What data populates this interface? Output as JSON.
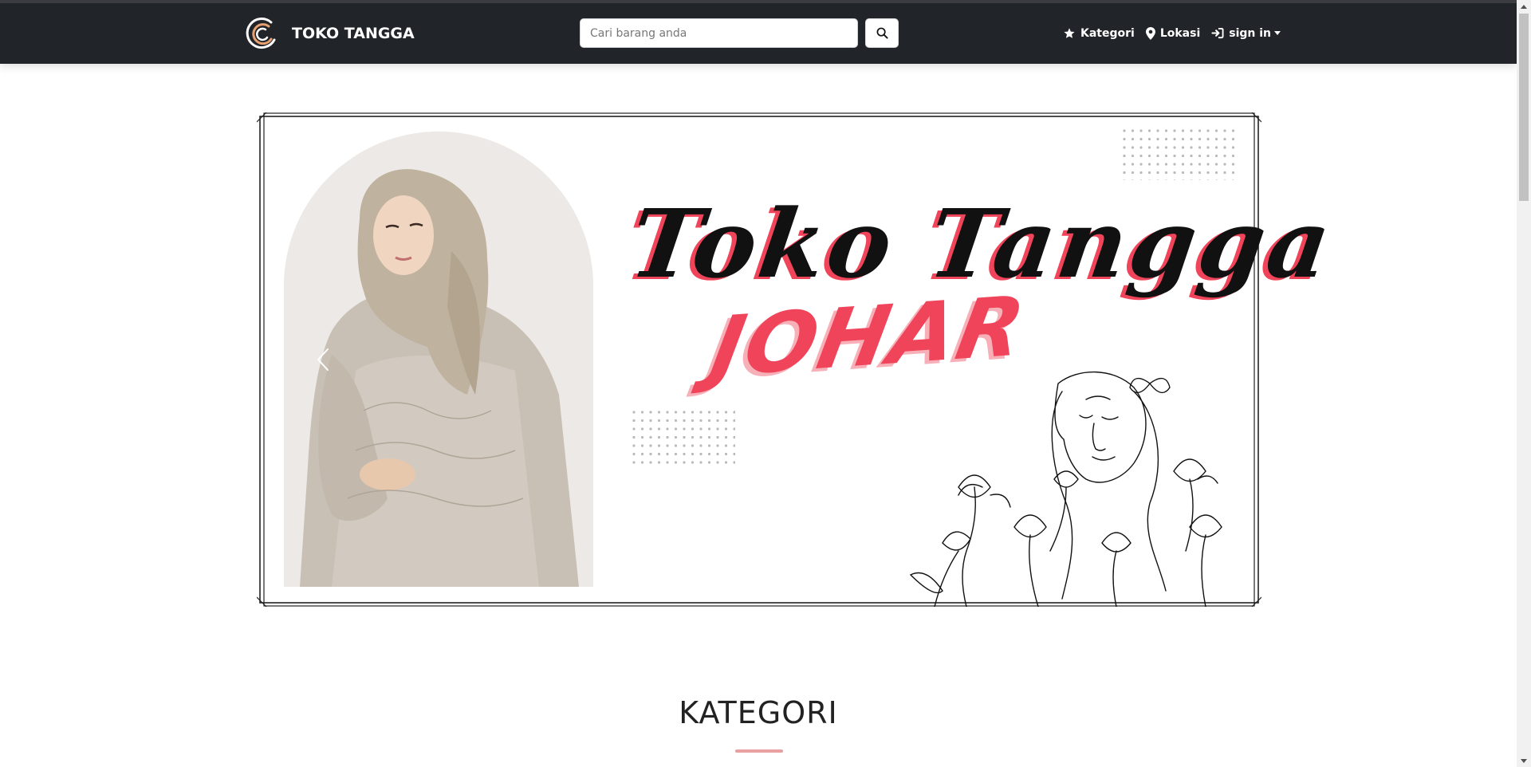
{
  "navbar": {
    "brand_name": "TOKO TANGGA",
    "search_placeholder": "Cari barang anda",
    "search_icon": "search-icon",
    "items": [
      {
        "label": "Kategori",
        "icon": "star-icon"
      },
      {
        "label": "Lokasi",
        "icon": "map-pin-icon"
      },
      {
        "label": "sign in",
        "icon": "sign-in-icon"
      }
    ]
  },
  "banner": {
    "title": "Toko Tangga",
    "subtitle": "JOHAR",
    "prev_icon": "chevron-left-icon"
  },
  "section": {
    "title": "KATEGORI"
  },
  "colors": {
    "navbar_bg": "#212529",
    "accent": "#f0445a",
    "underline": "#e9a0a0",
    "brand_orange": "#e8a070"
  }
}
